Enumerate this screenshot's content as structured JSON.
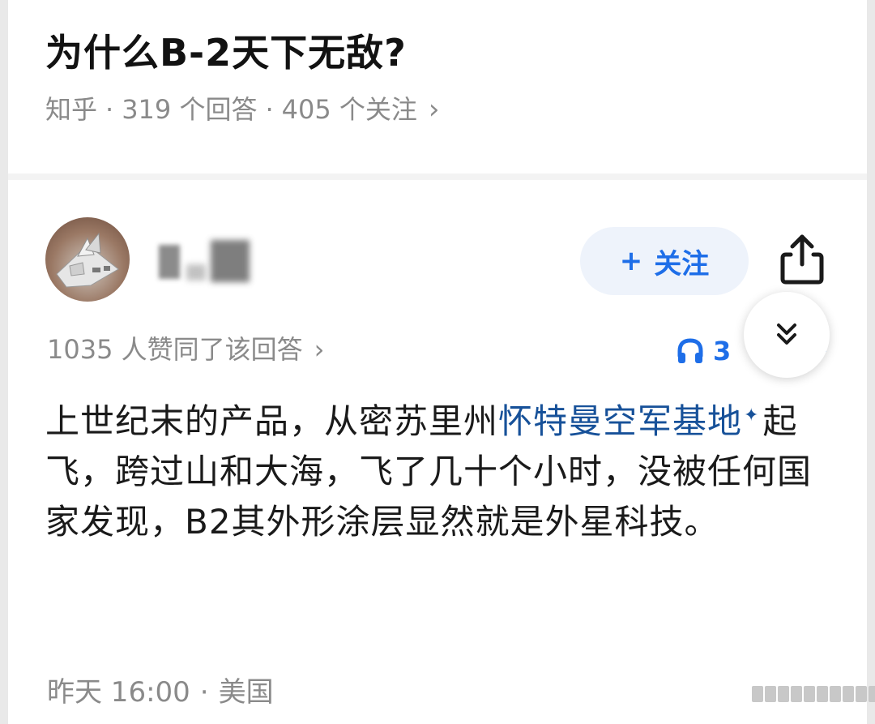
{
  "question": {
    "title": "为什么B-2天下无敌?",
    "source": "知乎",
    "answers_count": "319 个回答",
    "followers_count": "405 个关注",
    "separator": "·",
    "chevron": "›"
  },
  "answer": {
    "follow_label": "关注",
    "follow_plus": "+",
    "likes_text": "1035 人赞同了该回答",
    "likes_chevron": "›",
    "listen_count": "3",
    "content": {
      "part1": "上世纪末的产品，从密苏里州",
      "link": "怀特曼空军基地",
      "link_mark": "✦",
      "part2": "起飞，跨过山和大海，飞了几十个小时，没被任何国家发现，B2其外形涂层显然就是外星科技。"
    },
    "time": "昨天 16:00",
    "location": "美国",
    "separator": "·"
  },
  "icons": {
    "share": "share-icon",
    "collapse": "double-chevron-down-icon",
    "headphones": "headphones-icon",
    "avatar": "avatar"
  },
  "colors": {
    "accent": "#1e6ee8",
    "link": "#175199",
    "meta": "#8a8a8a",
    "follow_bg": "#eef3fb"
  }
}
